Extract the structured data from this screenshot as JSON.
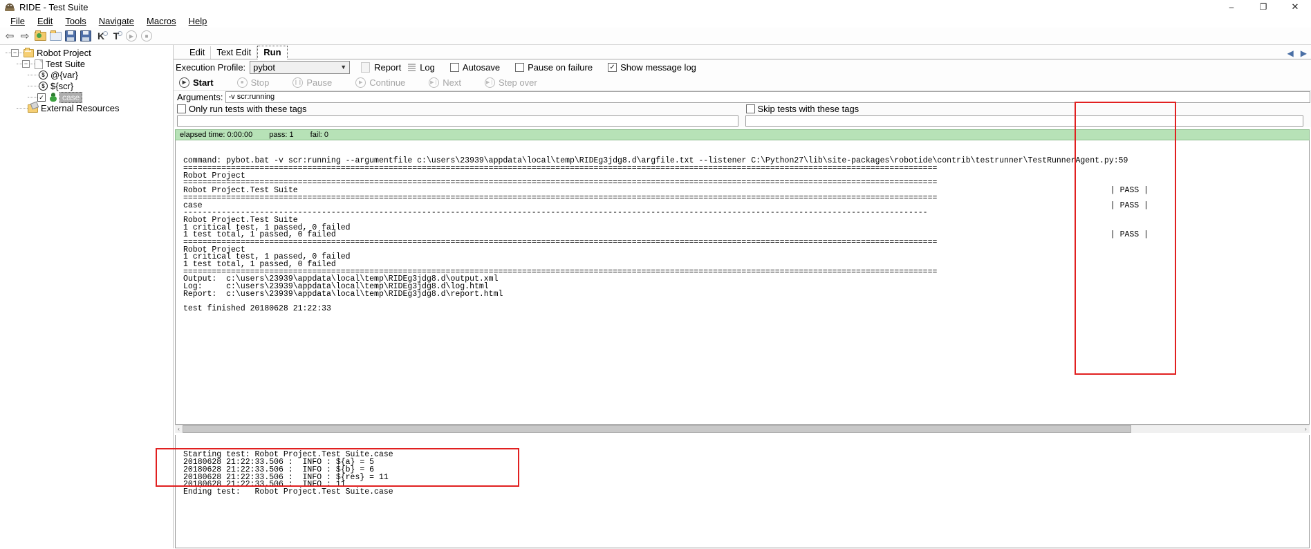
{
  "window": {
    "title": "RIDE - Test Suite",
    "icon": "robot-icon",
    "minimize": "–",
    "maximize": "❐",
    "close": "✕"
  },
  "menubar": {
    "items": [
      "File",
      "Edit",
      "Tools",
      "Navigate",
      "Macros",
      "Help"
    ]
  },
  "toolbar": {
    "items": [
      {
        "name": "back-icon",
        "glyph": "⇦"
      },
      {
        "name": "forward-icon",
        "glyph": "⇨"
      },
      {
        "name": "open-directory-icon",
        "glyph": ""
      },
      {
        "name": "open-file-icon",
        "glyph": ""
      },
      {
        "name": "save-icon",
        "glyph": ""
      },
      {
        "name": "save-all-icon",
        "glyph": ""
      },
      {
        "name": "search-keyword-icon",
        "glyph": "K"
      },
      {
        "name": "search-test-icon",
        "glyph": "T"
      },
      {
        "name": "run-icon",
        "glyph": "▶"
      },
      {
        "name": "stop-icon",
        "glyph": "■"
      }
    ]
  },
  "tree": {
    "items": [
      {
        "label": "Robot Project",
        "icon": "project-folder-icon",
        "depth": 0,
        "expander": "-"
      },
      {
        "label": "Test Suite",
        "icon": "file-icon",
        "depth": 1,
        "expander": "-"
      },
      {
        "label": "@{var}",
        "icon": "variable-icon",
        "depth": 2,
        "expander": ""
      },
      {
        "label": "${scr}",
        "icon": "variable-icon",
        "depth": 2,
        "expander": ""
      },
      {
        "label": "case",
        "icon": "test-case-robot-icon",
        "depth": 2,
        "expander": "",
        "selected": true,
        "checked": true
      },
      {
        "label": "External Resources",
        "icon": "external-resources-icon",
        "depth": 1,
        "expander": ""
      }
    ]
  },
  "tabs": [
    {
      "label": "Edit",
      "active": false
    },
    {
      "label": "Text Edit",
      "active": false
    },
    {
      "label": "Run",
      "active": true
    }
  ],
  "tab_scrollers": {
    "left": "◀",
    "right": "▶"
  },
  "run": {
    "execution_profile_label": "Execution Profile:",
    "execution_profile_value": "pybot",
    "report_label": "Report",
    "log_label": "Log",
    "checkboxes": [
      {
        "label": "Autosave",
        "checked": false
      },
      {
        "label": "Pause on failure",
        "checked": false
      },
      {
        "label": "Show message log",
        "checked": true
      }
    ],
    "controls": [
      {
        "label": "Start",
        "enabled": true,
        "glyph": "▶"
      },
      {
        "label": "Stop",
        "enabled": false,
        "glyph": "■"
      },
      {
        "label": "Pause",
        "enabled": false,
        "glyph": "❙❙"
      },
      {
        "label": "Continue",
        "enabled": false,
        "glyph": "▶"
      },
      {
        "label": "Next",
        "enabled": false,
        "glyph": "▶❘"
      },
      {
        "label": "Step over",
        "enabled": false,
        "glyph": "▶❘"
      }
    ],
    "arguments_label": "Arguments:",
    "arguments_value": "-v scr:running",
    "only_run_tags_label": "Only run tests with these tags",
    "only_run_tags_checked": false,
    "skip_tags_label": "Skip tests with these tags",
    "skip_tags_checked": false,
    "only_run_tags_value": "",
    "skip_tags_value": ""
  },
  "status": {
    "elapsed": "elapsed time: 0:00:00",
    "pass": "pass: 1",
    "fail": "fail: 0",
    "bg_color": "#b7e2b7"
  },
  "console": {
    "lines": [
      "command: pybot.bat -v scr:running --argumentfile c:\\users\\23939\\appdata\\local\\temp\\RIDEg3jdg8.d\\argfile.txt --listener C:\\Python27\\lib\\site-packages\\robotide\\contrib\\testrunner\\TestRunnerAgent.py:59",
      "==============================================================================================================================================================",
      "Robot Project",
      "==============================================================================================================================================================",
      "Robot Project.Test Suite",
      "==============================================================================================================================================================",
      "case",
      "------------------------------------------------------------------------------------------------------------------------------------------------------------",
      "Robot Project.Test Suite",
      "1 critical test, 1 passed, 0 failed",
      "1 test total, 1 passed, 0 failed",
      "==============================================================================================================================================================",
      "Robot Project",
      "1 critical test, 1 passed, 0 failed",
      "1 test total, 1 passed, 0 failed",
      "==============================================================================================================================================================",
      "Output:  c:\\users\\23939\\appdata\\local\\temp\\RIDEg3jdg8.d\\output.xml",
      "Log:     c:\\users\\23939\\appdata\\local\\temp\\RIDEg3jdg8.d\\log.html",
      "Report:  c:\\users\\23939\\appdata\\local\\temp\\RIDEg3jdg8.d\\report.html",
      "",
      "test finished 20180628 21:22:33"
    ],
    "pass_markers": [
      {
        "line": 6,
        "text": "| PASS |"
      },
      {
        "line": 8,
        "text": "| PASS |"
      },
      {
        "line": 12,
        "text": "| PASS |"
      }
    ],
    "scroll_left_arrow": "‹",
    "scroll_right_arrow": "›"
  },
  "message_log": {
    "lines": [
      "Starting test: Robot Project.Test Suite.case",
      "20180628 21:22:33.506 :  INFO : ${a} = 5",
      "20180628 21:22:33.506 :  INFO : ${b} = 6",
      "20180628 21:22:33.506 :  INFO : ${res} = 11",
      "20180628 21:22:33.506 :  INFO : 11",
      "Ending test:   Robot Project.Test Suite.case"
    ]
  },
  "annotations": {
    "highlight_color": "#e12020",
    "boxes": [
      {
        "name": "pass-column-highlight"
      },
      {
        "name": "message-log-highlight"
      }
    ]
  }
}
